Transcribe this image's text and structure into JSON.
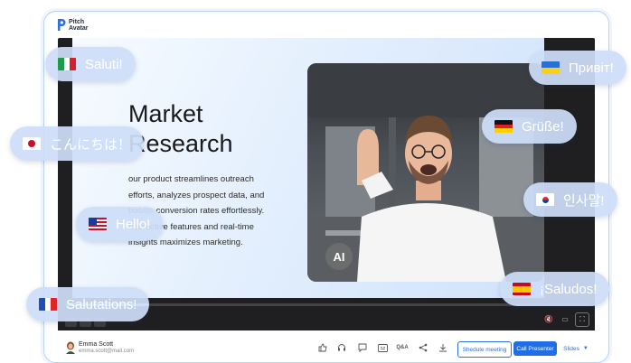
{
  "app": {
    "logo_line1": "Pitch",
    "logo_line2": "Avatar",
    "brand_color": "#2f6fdb"
  },
  "slide": {
    "title_line1": "Market",
    "title_line2": "Research",
    "body_lines": [
      "our product streamlines outreach",
      "efforts, analyzes prospect data, and",
      "boosts conversion rates effortlessly.",
      "Interactive features and real-time",
      "insights maximizes marketing."
    ],
    "ai_badge": "AI"
  },
  "greetings": [
    {
      "text": "Saluti!",
      "flag": "italy-flag"
    },
    {
      "text": "Привіт!",
      "flag": "ukraine-flag"
    },
    {
      "text": "Grüße!",
      "flag": "germany-flag"
    },
    {
      "text": "こんにちは！",
      "flag": "japan-flag"
    },
    {
      "text": "인사말!",
      "flag": "south-korea-flag"
    },
    {
      "text": "Hello!",
      "flag": "usa-flag"
    },
    {
      "text": "Salutations!",
      "flag": "france-flag"
    },
    {
      "text": "¡Saludos!",
      "flag": "spain-flag"
    }
  ],
  "user": {
    "name": "Emma Scott",
    "email": "emma.scott@mail.com"
  },
  "toolbar": {
    "icons": [
      "thumbs-up-icon",
      "headset-icon",
      "chat-icon",
      "captions-icon",
      "qa-icon",
      "share-icon",
      "download-icon"
    ],
    "qa_label": "Q&A",
    "meeting_label": "Shedule meeting",
    "call_label": "Call Presenter",
    "slides_label": "Slides"
  }
}
